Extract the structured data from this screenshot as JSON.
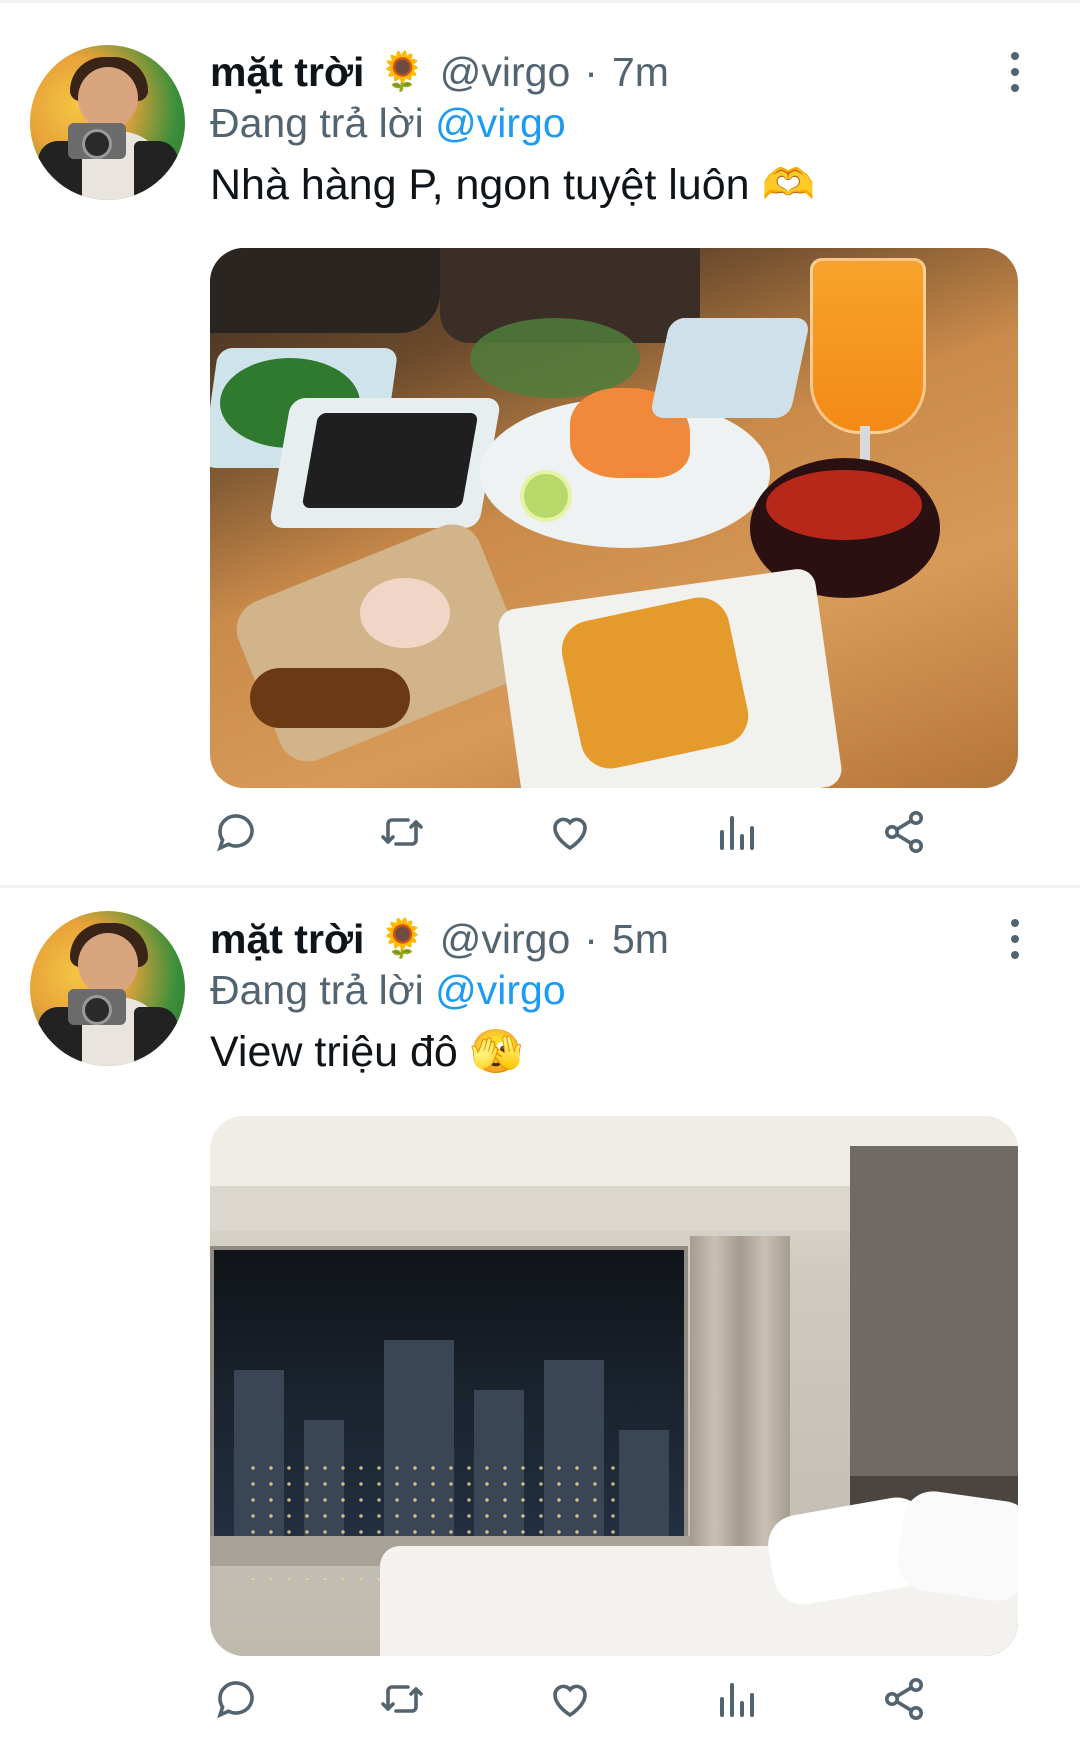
{
  "tweets": [
    {
      "author_name": "mặt trời",
      "author_emoji": "🌻",
      "handle": "@virgo",
      "separator": "·",
      "time": "7m",
      "reply_prefix": "Đang trả lời",
      "reply_to": "@virgo",
      "text": "Nhà hàng P, ngon tuyệt luôn",
      "text_emoji": "🫶",
      "media": "restaurant-food-photo"
    },
    {
      "author_name": "mặt trời",
      "author_emoji": "🌻",
      "handle": "@virgo",
      "separator": "·",
      "time": "5m",
      "reply_prefix": "Đang trả lời",
      "reply_to": "@virgo",
      "text": "View triệu đô",
      "text_emoji": "🫣",
      "media": "hotel-room-night-view-photo"
    }
  ],
  "icons": {
    "reply": "speech-bubble-icon",
    "retweet": "retweet-icon",
    "like": "heart-icon",
    "views": "bar-chart-icon",
    "share": "share-icon",
    "more": "vertical-dots-icon"
  },
  "colors": {
    "text": "#0f1419",
    "secondary": "#536471",
    "link": "#1d9bf0",
    "divider": "#eff3f4"
  }
}
